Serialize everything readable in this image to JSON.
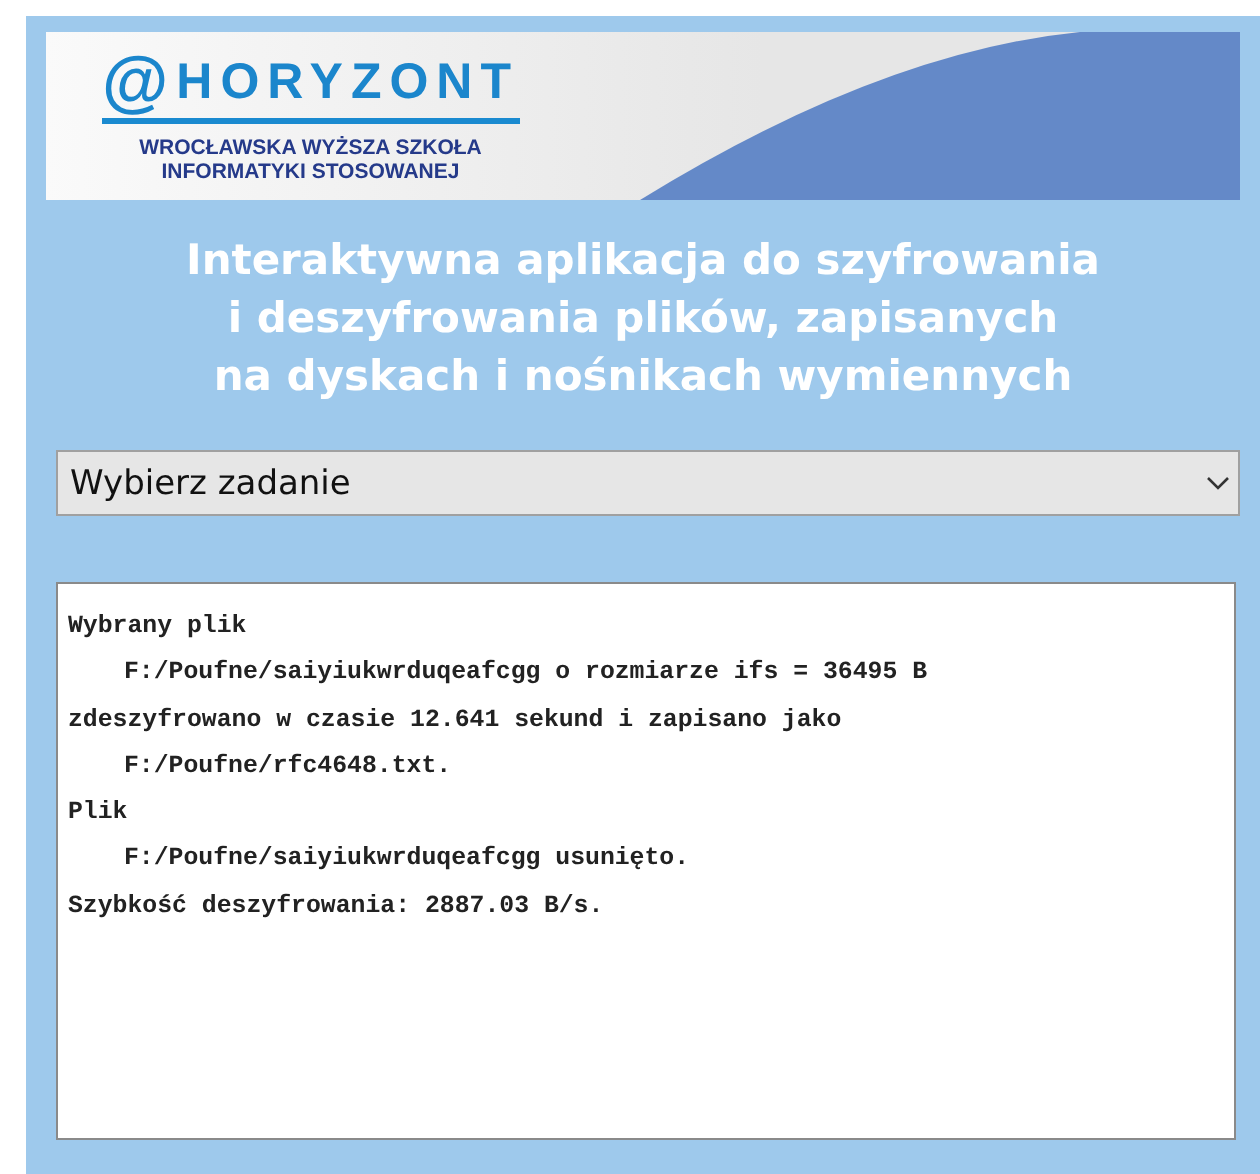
{
  "banner": {
    "logo_text": "HORYZONT",
    "logo_at": "@",
    "school_line_1": "WROCŁAWSKA WYŻSZA SZKOŁA",
    "school_line_2": "INFORMATYKI STOSOWANEJ"
  },
  "title": [
    "Interaktywna aplikacja do szyfrowania",
    "i deszyfrowania plików, zapisanych",
    "na dyskach i nośnikach wymiennych"
  ],
  "task_select": {
    "value": "Wybierz zadanie"
  },
  "log": [
    {
      "text": "Wybrany plik",
      "indented": false
    },
    {
      "text": "F:/Poufne/saiyiukwrduqeafcgg o rozmiarze ifs = 36495 B",
      "indented": true
    },
    {
      "text": "zdeszyfrowano w czasie 12.641 sekund i zapisano jako",
      "indented": false
    },
    {
      "text": "F:/Poufne/rfc4648.txt.",
      "indented": true
    },
    {
      "text": "Plik",
      "indented": false
    },
    {
      "text": "F:/Poufne/saiyiukwrduqeafcgg usunięto.",
      "indented": true
    },
    {
      "text": "Szybkość deszyfrowania: 2887.03 B/s.",
      "indented": false
    }
  ]
}
